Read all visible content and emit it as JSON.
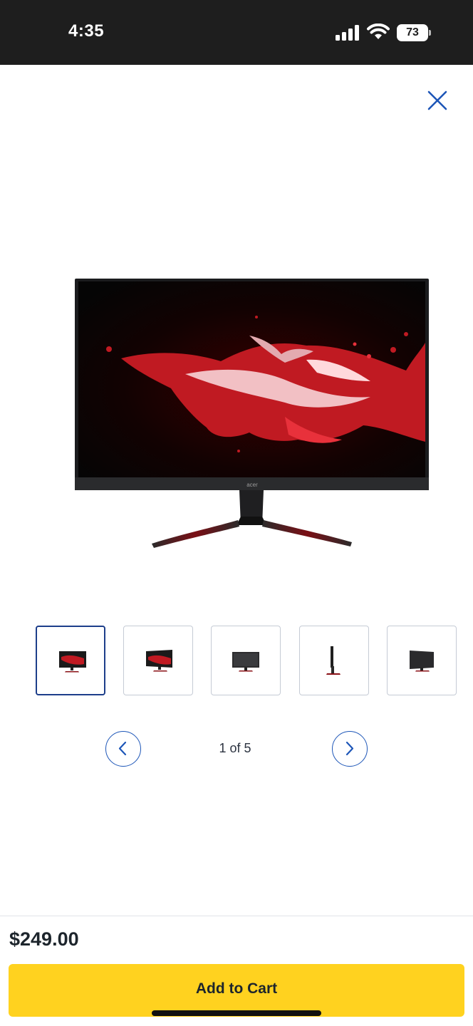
{
  "status_bar": {
    "time": "4:35",
    "battery": "73",
    "icons": [
      "cellular-signal-icon",
      "wifi-icon",
      "battery-icon"
    ]
  },
  "close_icon": "close-x-icon",
  "gallery": {
    "main_image": "acer-monitor-front-view",
    "thumbnails": [
      {
        "view": "front",
        "selected": true
      },
      {
        "view": "angle-right",
        "selected": false
      },
      {
        "view": "front-dark",
        "selected": false
      },
      {
        "view": "side",
        "selected": false
      },
      {
        "view": "angle-left",
        "selected": false
      }
    ],
    "page_indicator": "1 of 5",
    "prev_icon": "chevron-left-icon",
    "next_icon": "chevron-right-icon"
  },
  "purchase": {
    "price": "$249.00",
    "add_to_cart_label": "Add to Cart"
  },
  "colors": {
    "accent_blue": "#1d56b8",
    "cart_yellow": "#ffd21f",
    "status_bar": "#1e1e1e",
    "text_dark": "#1d252c"
  },
  "brand_logo_text": "acer"
}
